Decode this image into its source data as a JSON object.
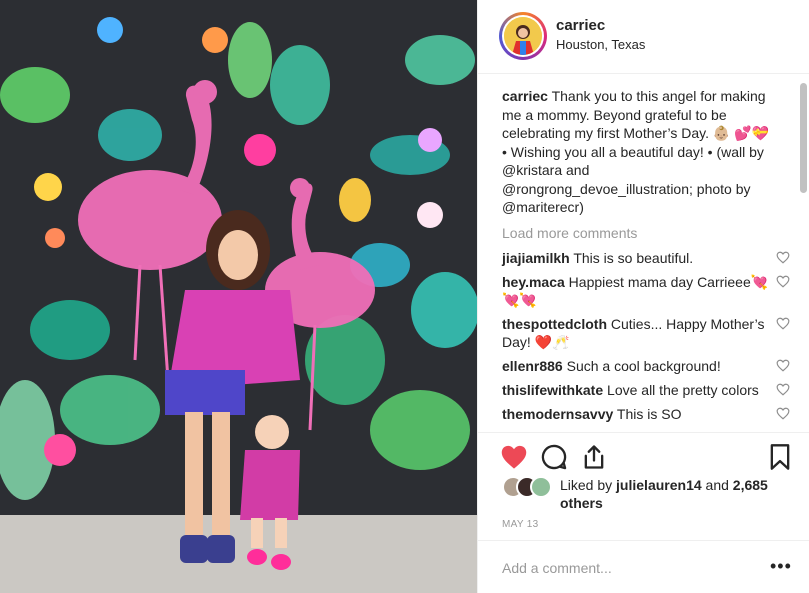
{
  "post": {
    "username": "carriec",
    "location": "Houston, Texas",
    "caption_user": "carriec",
    "caption_text": "Thank you to this angel for making me a mommy. Beyond grateful to be celebrating my first Mother’s Day. 👶🏼 💕💝 • Wishing you all a beautiful day! • (wall by @kristara and @rongrong_devoe_illustration; photo by @mariterecr)"
  },
  "load_more": "Load more comments",
  "comments": [
    {
      "user": "jiajiamilkh",
      "text": "This is so beautiful."
    },
    {
      "user": "hey.maca",
      "text": "Happiest mama day Carrieee💘💘💘"
    },
    {
      "user": "thespottedcloth",
      "text": "Cuties... Happy Mother’s Day! ❤️🥂"
    },
    {
      "user": "ellenr886",
      "text": "Such a cool background!"
    },
    {
      "user": "thislifewithkate",
      "text": "Love all the pretty colors"
    },
    {
      "user": "themodernsavvy",
      "text": "This is SO"
    }
  ],
  "likes": {
    "prefix": "Liked by ",
    "user": "julielauren14",
    "mid": " and ",
    "others": "2,685 others"
  },
  "date": "MAY 13",
  "add_comment_placeholder": "Add a comment...",
  "more_options": "•••",
  "colors": {
    "like_red": "#ed4956",
    "text": "#262626",
    "muted": "#999999",
    "border": "#efefef"
  },
  "icons": [
    "heart-filled-icon",
    "comment-icon",
    "share-icon",
    "bookmark-icon",
    "heart-outline-icon"
  ]
}
